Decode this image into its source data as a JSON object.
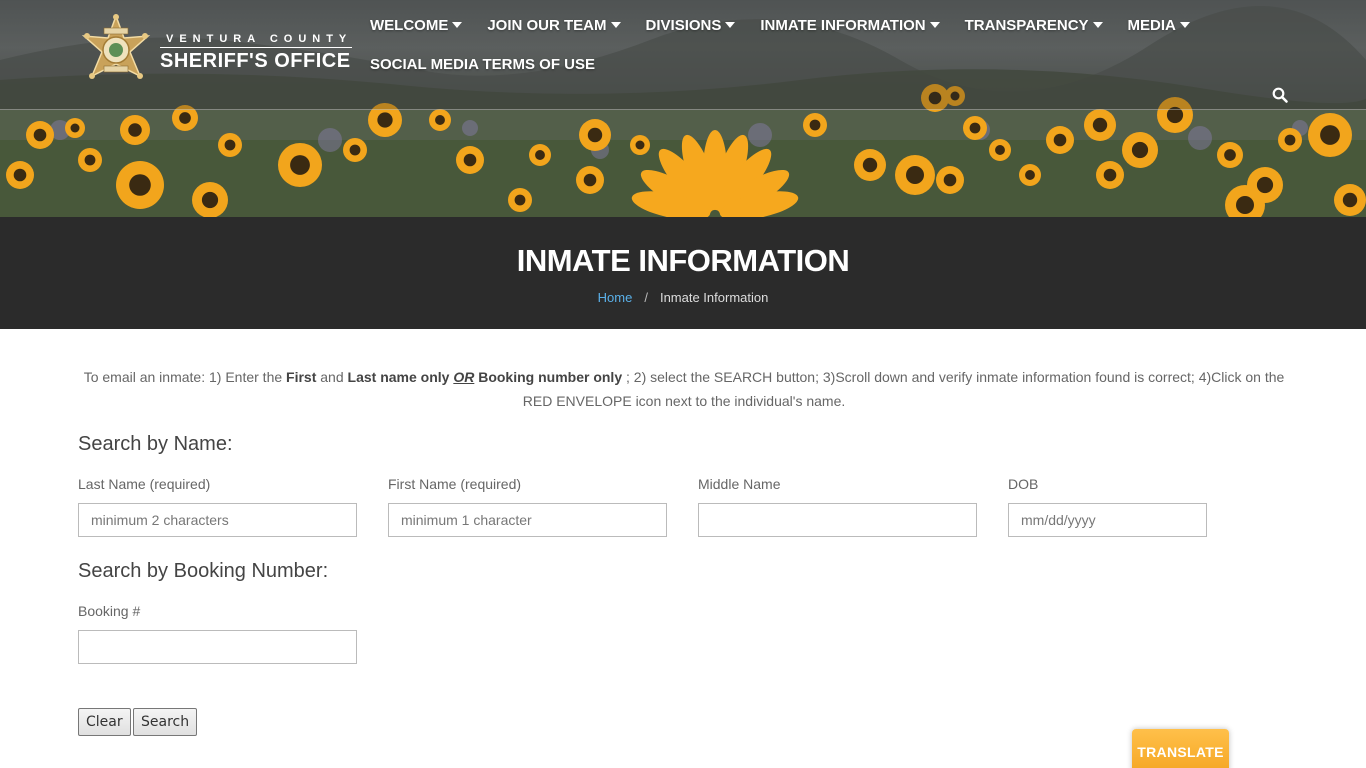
{
  "header": {
    "logo_county": "VENTURA COUNTY",
    "logo_office": "SHERIFF'S OFFICE",
    "nav_row1": [
      {
        "label": "WELCOME",
        "has_dropdown": true
      },
      {
        "label": "JOIN OUR TEAM",
        "has_dropdown": true
      },
      {
        "label": "DIVISIONS",
        "has_dropdown": true
      },
      {
        "label": "INMATE INFORMATION",
        "has_dropdown": true
      },
      {
        "label": "TRANSPARENCY",
        "has_dropdown": true
      },
      {
        "label": "MEDIA",
        "has_dropdown": true
      }
    ],
    "nav_row2": [
      {
        "label": "SOCIAL MEDIA TERMS OF USE",
        "has_dropdown": false
      }
    ],
    "search_icon": "search-icon"
  },
  "title_band": {
    "title": "INMATE INFORMATION",
    "breadcrumb": {
      "home": "Home",
      "separator": "/",
      "current": "Inmate Information"
    }
  },
  "instructions": {
    "p1": "To email an inmate: 1) Enter the ",
    "first": "First",
    "and": " and ",
    "last_only": "Last name only",
    "space": " ",
    "or": "OR",
    "booking_only": " Booking number only",
    "p2": " ; 2) select the SEARCH button;  3)Scroll down and verify inmate information found is correct; 4)Click on the RED ENVELOPE icon next to the individual's name."
  },
  "search_by_name": {
    "title": "Search by Name:",
    "last_name_label": "Last Name (required)",
    "last_name_placeholder": "minimum 2 characters",
    "first_name_label": "First Name (required)",
    "first_name_placeholder": "minimum 1 character",
    "middle_name_label": "Middle Name",
    "middle_name_placeholder": "",
    "dob_label": "DOB",
    "dob_placeholder": "mm/dd/yyyy"
  },
  "search_by_booking": {
    "title": "Search by Booking Number:",
    "booking_label": "Booking #",
    "booking_placeholder": ""
  },
  "buttons": {
    "clear": "Clear",
    "search": "Search"
  },
  "translate": {
    "label": "TRANSLATE",
    "color": "#f5a623"
  },
  "colors": {
    "title_band": "#2b2b2b",
    "breadcrumb_link": "#5ab0e8"
  }
}
